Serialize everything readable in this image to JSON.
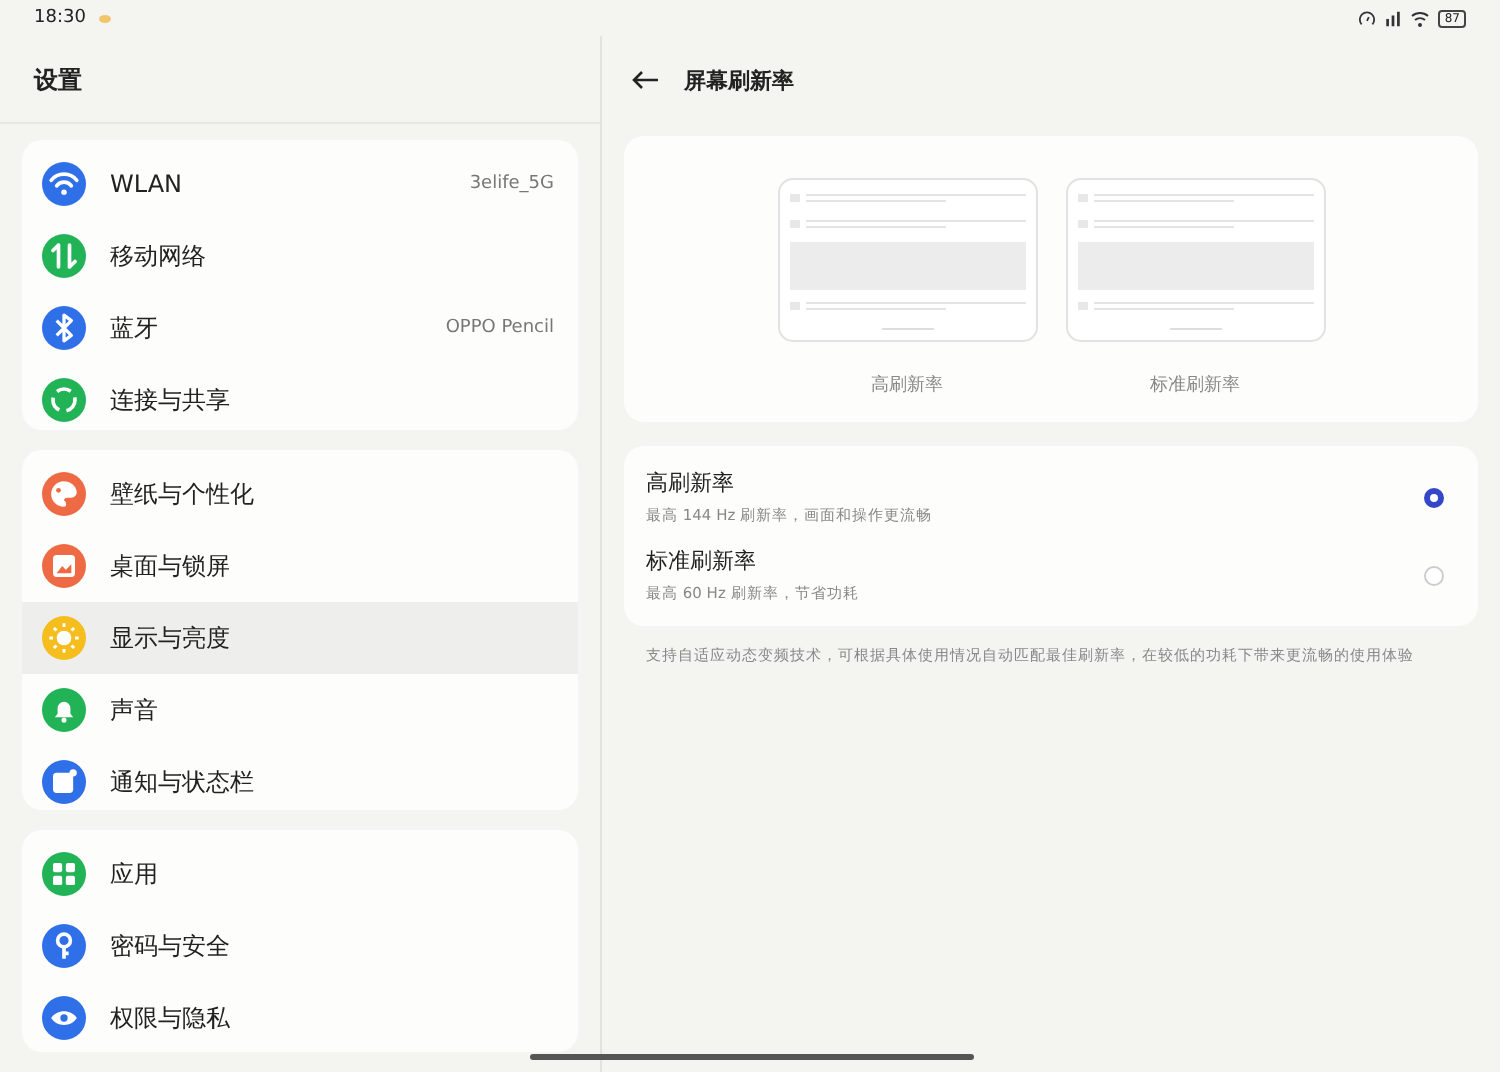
{
  "status_bar": {
    "time": "18:30",
    "battery": "87"
  },
  "sidebar": {
    "title": "设置",
    "groups": [
      [
        {
          "label": "WLAN",
          "value": "3elife_5G",
          "kind": "wifi",
          "color": "#2f6fe8",
          "selected": false
        },
        {
          "label": "移动网络",
          "kind": "data",
          "color": "#21b356",
          "selected": false
        },
        {
          "label": "蓝牙",
          "value": "OPPO Pencil",
          "kind": "bluetooth",
          "color": "#2f6fe8",
          "selected": false
        },
        {
          "label": "连接与共享",
          "kind": "share",
          "color": "#21b356",
          "selected": false
        }
      ],
      [
        {
          "label": "壁纸与个性化",
          "kind": "palette",
          "color": "#ee6a45",
          "selected": false
        },
        {
          "label": "桌面与锁屏",
          "kind": "picture",
          "color": "#ee6a45",
          "selected": false
        },
        {
          "label": "显示与亮度",
          "kind": "sun",
          "color": "#f6bd1e",
          "selected": true
        },
        {
          "label": "声音",
          "kind": "bell",
          "color": "#21b356",
          "selected": false
        },
        {
          "label": "通知与状态栏",
          "kind": "notice",
          "color": "#2f6fe8",
          "selected": false
        }
      ],
      [
        {
          "label": "应用",
          "kind": "apps",
          "color": "#21b356",
          "selected": false
        },
        {
          "label": "密码与安全",
          "kind": "key",
          "color": "#2f6fe8",
          "selected": false
        },
        {
          "label": "权限与隐私",
          "kind": "eye",
          "color": "#2f6fe8",
          "selected": false
        }
      ]
    ]
  },
  "detail": {
    "title": "屏幕刷新率",
    "previews": [
      {
        "label": "高刷新率"
      },
      {
        "label": "标准刷新率"
      }
    ],
    "options": [
      {
        "title": "高刷新率",
        "subtitle": "最高 144 Hz 刷新率，画面和操作更流畅",
        "selected": true
      },
      {
        "title": "标准刷新率",
        "subtitle": "最高 60 Hz 刷新率，节省功耗",
        "selected": false
      }
    ],
    "note": "支持自适应动态变频技术，可根据具体使用情况自动匹配最佳刷新率，在较低的功耗下带来更流畅的使用体验"
  }
}
